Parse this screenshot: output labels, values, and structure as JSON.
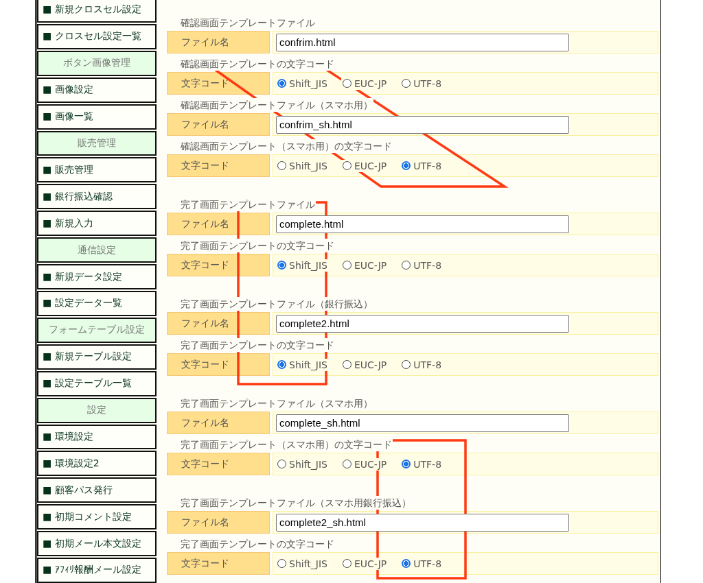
{
  "sidebar": {
    "items": [
      {
        "kind": "link",
        "label": "■ 新規クロスセル設定"
      },
      {
        "kind": "link",
        "label": "■ クロスセル設定一覧"
      },
      {
        "kind": "header",
        "label": "ボタン画像管理"
      },
      {
        "kind": "link",
        "label": "■ 画像設定"
      },
      {
        "kind": "link",
        "label": "■ 画像一覧"
      },
      {
        "kind": "header",
        "label": "販売管理"
      },
      {
        "kind": "link",
        "label": "■ 販売管理"
      },
      {
        "kind": "link",
        "label": "■ 銀行振込確認"
      },
      {
        "kind": "link",
        "label": "■ 新規入力"
      },
      {
        "kind": "header",
        "label": "通信設定"
      },
      {
        "kind": "link",
        "label": "■ 新規データ設定"
      },
      {
        "kind": "link",
        "label": "■ 設定データ一覧"
      },
      {
        "kind": "header",
        "label": "フォームテーブル設定"
      },
      {
        "kind": "link",
        "label": "■ 新規テーブル設定"
      },
      {
        "kind": "link",
        "label": "■ 設定テーブル一覧"
      },
      {
        "kind": "header",
        "label": "設定"
      },
      {
        "kind": "link",
        "label": "■ 環境設定"
      },
      {
        "kind": "link",
        "label": "■ 環境設定2"
      },
      {
        "kind": "link",
        "label": "■ 顧客パス発行"
      },
      {
        "kind": "link",
        "label": "■ 初期コメント設定"
      },
      {
        "kind": "link",
        "label": "■ 初期メール本文設定"
      },
      {
        "kind": "link",
        "label": "■ ｱﾌｨﾘ報酬メール設定"
      }
    ]
  },
  "sections": [
    {
      "rows": [
        {
          "caption": "確認画面テンプレートファイル",
          "kind": "file",
          "label": "ファイル名",
          "value": "confrim.html"
        },
        {
          "caption": "確認画面テンプレートの文字コード",
          "kind": "encoding",
          "label": "文字コード",
          "options": [
            {
              "label": "Shift_JIS",
              "selected": true
            },
            {
              "label": "EUC-JP",
              "selected": false
            },
            {
              "label": "UTF-8",
              "selected": false
            }
          ]
        },
        {
          "caption": "確認画面テンプレートファイル（スマホ用）",
          "kind": "file",
          "label": "ファイル名",
          "value": "confrim_sh.html"
        },
        {
          "caption": "確認画面テンプレート（スマホ用）の文字コード",
          "kind": "encoding",
          "label": "文字コード",
          "options": [
            {
              "label": "Shift_JIS",
              "selected": false
            },
            {
              "label": "EUC-JP",
              "selected": false
            },
            {
              "label": "UTF-8",
              "selected": true
            }
          ]
        }
      ]
    },
    {
      "rows": [
        {
          "caption": "完了画面テンプレートファイル",
          "kind": "file",
          "label": "ファイル名",
          "value": "complete.html"
        },
        {
          "caption": "完了画面テンプレートの文字コード",
          "kind": "encoding",
          "label": "文字コード",
          "options": [
            {
              "label": "Shift_JIS",
              "selected": true
            },
            {
              "label": "EUC-JP",
              "selected": false
            },
            {
              "label": "UTF-8",
              "selected": false
            }
          ]
        }
      ]
    },
    {
      "rows": [
        {
          "caption": "完了画面テンプレートファイル（銀行振込）",
          "kind": "file",
          "label": "ファイル名",
          "value": "complete2.html"
        },
        {
          "caption": "完了画面テンプレートの文字コード",
          "kind": "encoding",
          "label": "文字コード",
          "options": [
            {
              "label": "Shift_JIS",
              "selected": true
            },
            {
              "label": "EUC-JP",
              "selected": false
            },
            {
              "label": "UTF-8",
              "selected": false
            }
          ]
        }
      ]
    },
    {
      "rows": [
        {
          "caption": "完了画面テンプレートファイル（スマホ用）",
          "kind": "file",
          "label": "ファイル名",
          "value": "complete_sh.html"
        },
        {
          "caption": "完了画面テンプレート（スマホ用）の文字コード",
          "kind": "encoding",
          "label": "文字コード",
          "options": [
            {
              "label": "Shift_JIS",
              "selected": false
            },
            {
              "label": "EUC-JP",
              "selected": false
            },
            {
              "label": "UTF-8",
              "selected": true
            }
          ]
        }
      ]
    },
    {
      "rows": [
        {
          "caption": "完了画面テンプレートファイル（スマホ用銀行振込）",
          "kind": "file",
          "label": "ファイル名",
          "value": "complete2_sh.html"
        },
        {
          "caption": "完了画面テンプレートの文字コード",
          "kind": "encoding",
          "label": "文字コード",
          "options": [
            {
              "label": "Shift_JIS",
              "selected": false
            },
            {
              "label": "EUC-JP",
              "selected": false
            },
            {
              "label": "UTF-8",
              "selected": true
            }
          ]
        }
      ]
    }
  ]
}
